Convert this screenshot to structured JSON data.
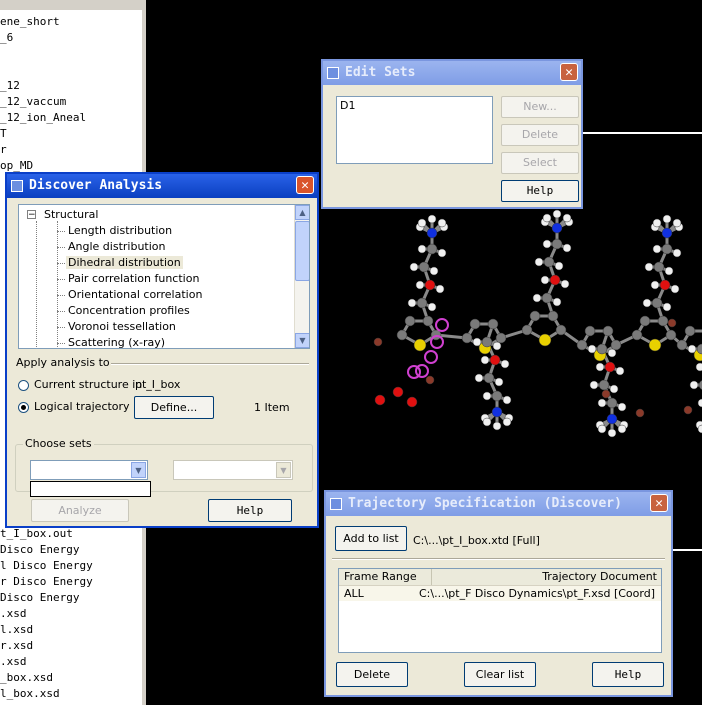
{
  "file_list": {
    "items": [
      "ene_short",
      "_6",
      "_12",
      "_12_vaccum",
      "_12_ion_Aneal",
      "T",
      "r",
      "op_MD",
      "t_I_box.out",
      " Disco Energy",
      "l Disco Energy",
      "r Disco Energy",
      " Disco Energy",
      ".xsd",
      "l.xsd",
      "r.xsd",
      ".xsd",
      "_box.xsd",
      "l_box.xsd"
    ]
  },
  "edit_sets": {
    "title": "Edit Sets",
    "list_items": [
      "D1"
    ],
    "buttons": {
      "new": "New...",
      "delete": "Delete",
      "select": "Select",
      "help": "Help"
    }
  },
  "discover_analysis": {
    "title": "Discover Analysis",
    "tree": {
      "root": "Structural",
      "items": [
        "Length distribution",
        "Angle distribution",
        "Dihedral distribution",
        "Pair correlation function",
        "Orientational correlation",
        "Concentration profiles",
        "Voronoi tessellation",
        "Scattering (x-ray)"
      ],
      "selected_index": 2
    },
    "apply_label": "Apply analysis to",
    "current_structure_label": "Current structure in",
    "current_structure_value": "pt_I_box",
    "logical_trajectory_label": "Logical trajectory",
    "define_button": "Define...",
    "item_count": "1 Item",
    "choose_sets_label": "Choose sets",
    "set1_value": "",
    "set2_value": "",
    "analyze_button": "Analyze",
    "help_button": "Help"
  },
  "trajectory_spec": {
    "title": "Trajectory Specification (Discover)",
    "add_button": "Add to list",
    "current_path": "C:\\...\\pt_I_box.xtd [Full]",
    "columns": [
      "Frame Range",
      "Trajectory Document"
    ],
    "rows": [
      {
        "frame_range": "ALL",
        "document": "C:\\...\\pt_F Disco Dynamics\\pt_F.xsd [Coord]"
      }
    ],
    "delete_button": "Delete",
    "clear_button": "Clear list",
    "help_button": "Help"
  },
  "colors": {
    "title_active": "#0a3fc8",
    "dialog_bg": "#ece9d8",
    "viewport_bg": "#000000",
    "carbon": "#7a7a7a",
    "hydrogen": "#f0f0f0",
    "sulfur": "#e8d000",
    "oxygen": "#e01010",
    "nitrogen": "#1030e0",
    "highlight": "#d040d0"
  }
}
